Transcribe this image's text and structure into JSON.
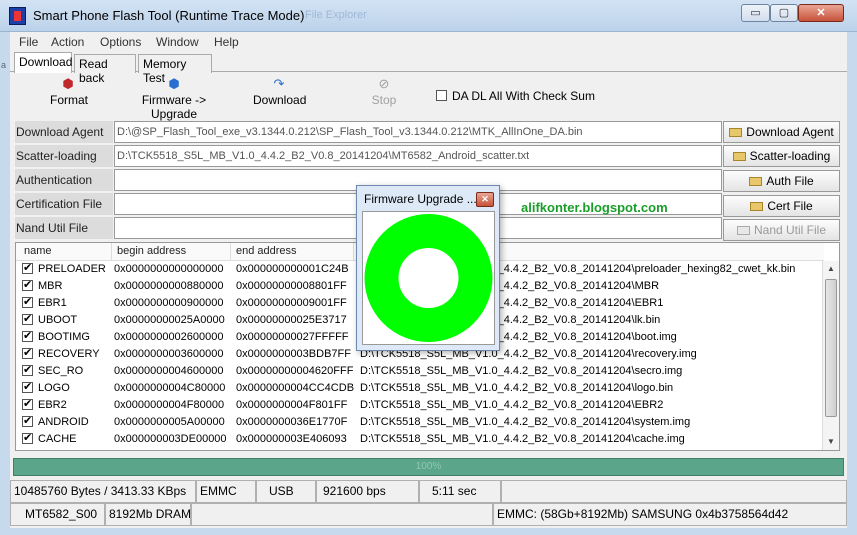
{
  "window": {
    "title": "Smart Phone Flash Tool (Runtime Trace Mode)",
    "background_ghost": "File Explorer",
    "controls": {
      "minimize": "▭",
      "maximize": "▢",
      "close": "✕"
    }
  },
  "menu": [
    "File",
    "Action",
    "Options",
    "Window",
    "Help"
  ],
  "tabs": [
    {
      "label": "Download",
      "active": true
    },
    {
      "label": "Read back",
      "active": false
    },
    {
      "label": "Memory Test",
      "active": false
    }
  ],
  "toolbar": {
    "format": {
      "label": "Format",
      "icon": "format-icon"
    },
    "firmware_upgrade": {
      "label": "Firmware -> Upgrade",
      "icon": "firmware-upgrade-icon"
    },
    "download": {
      "label": "Download",
      "icon": "download-icon"
    },
    "stop": {
      "label": "Stop",
      "icon": "stop-icon",
      "disabled": true
    },
    "checksum": {
      "label": "DA DL All With Check Sum",
      "checked": false
    }
  },
  "fields": {
    "download_agent": {
      "label": "Download Agent",
      "value": "D:\\@SP_Flash_Tool_exe_v3.1344.0.212\\SP_Flash_Tool_v3.1344.0.212\\MTK_AllInOne_DA.bin",
      "button": "Download Agent"
    },
    "scatter": {
      "label": "Scatter-loading File",
      "value": "D:\\TCK5518_S5L_MB_V1.0_4.4.2_B2_V0.8_20141204\\MT6582_Android_scatter.txt",
      "button": "Scatter-loading"
    },
    "auth": {
      "label": "Authentication File",
      "value": "",
      "button": "Auth File"
    },
    "cert": {
      "label": "Certification File",
      "value": "",
      "button": "Cert File"
    },
    "nand": {
      "label": "Nand Util File",
      "value": "",
      "button": "Nand Util File"
    }
  },
  "table": {
    "headers": [
      "name",
      "begin address",
      "end address",
      "location"
    ],
    "rows": [
      {
        "checked": true,
        "name": "PRELOADER",
        "begin": "0x0000000000000000",
        "end": "0x000000000001C24B",
        "location": "D:\\TCK5518_S5L_MB_V1.0_4.4.2_B2_V0.8_20141204\\preloader_hexing82_cwet_kk.bin"
      },
      {
        "checked": true,
        "name": "MBR",
        "begin": "0x0000000000880000",
        "end": "0x00000000008801FF",
        "location": "D:\\TCK5518_S5L_MB_V1.0_4.4.2_B2_V0.8_20141204\\MBR"
      },
      {
        "checked": true,
        "name": "EBR1",
        "begin": "0x0000000000900000",
        "end": "0x00000000009001FF",
        "location": "D:\\TCK5518_S5L_MB_V1.0_4.4.2_B2_V0.8_20141204\\EBR1"
      },
      {
        "checked": true,
        "name": "UBOOT",
        "begin": "0x00000000025A0000",
        "end": "0x00000000025E3717",
        "location": "D:\\TCK5518_S5L_MB_V1.0_4.4.2_B2_V0.8_20141204\\lk.bin"
      },
      {
        "checked": true,
        "name": "BOOTIMG",
        "begin": "0x0000000002600000",
        "end": "0x00000000027FFFFF",
        "location": "D:\\TCK5518_S5L_MB_V1.0_4.4.2_B2_V0.8_20141204\\boot.img"
      },
      {
        "checked": true,
        "name": "RECOVERY",
        "begin": "0x0000000003600000",
        "end": "0x0000000003BDB7FF",
        "location": "D:\\TCK5518_S5L_MB_V1.0_4.4.2_B2_V0.8_20141204\\recovery.img"
      },
      {
        "checked": true,
        "name": "SEC_RO",
        "begin": "0x0000000004600000",
        "end": "0x00000000004620FFF",
        "location": "D:\\TCK5518_S5L_MB_V1.0_4.4.2_B2_V0.8_20141204\\secro.img"
      },
      {
        "checked": true,
        "name": "LOGO",
        "begin": "0x0000000004C80000",
        "end": "0x0000000004CC4CDB",
        "location": "D:\\TCK5518_S5L_MB_V1.0_4.4.2_B2_V0.8_20141204\\logo.bin"
      },
      {
        "checked": true,
        "name": "EBR2",
        "begin": "0x0000000004F80000",
        "end": "0x0000000004F801FF",
        "location": "D:\\TCK5518_S5L_MB_V1.0_4.4.2_B2_V0.8_20141204\\EBR2"
      },
      {
        "checked": true,
        "name": "ANDROID",
        "begin": "0x0000000005A00000",
        "end": "0x0000000036E1770F",
        "location": "D:\\TCK5518_S5L_MB_V1.0_4.4.2_B2_V0.8_20141204\\system.img"
      },
      {
        "checked": true,
        "name": "CACHE",
        "begin": "0x000000003DE00000",
        "end": "0x000000003E406093",
        "location": "D:\\TCK5518_S5L_MB_V1.0_4.4.2_B2_V0.8_20141204\\cache.img"
      }
    ]
  },
  "progress": {
    "label": "100%",
    "fraction": 1.0,
    "color": "#5ba58a"
  },
  "status1": {
    "bytes": "10485760 Bytes / 3413.33 KBps",
    "storage": "EMMC",
    "port": "USB",
    "baud": "921600 bps",
    "time": "5:11 sec"
  },
  "status2": {
    "chip": "MT6582_S00",
    "ram": "8192Mb DRAM",
    "emmc": "EMMC: (58Gb+8192Mb) SAMSUNG 0x4b3758564d42"
  },
  "dialog": {
    "title": "Firmware Upgrade ...",
    "close": "✕",
    "ring_color": "#00ff00"
  },
  "watermark": "alifkonter.blogspot.com"
}
